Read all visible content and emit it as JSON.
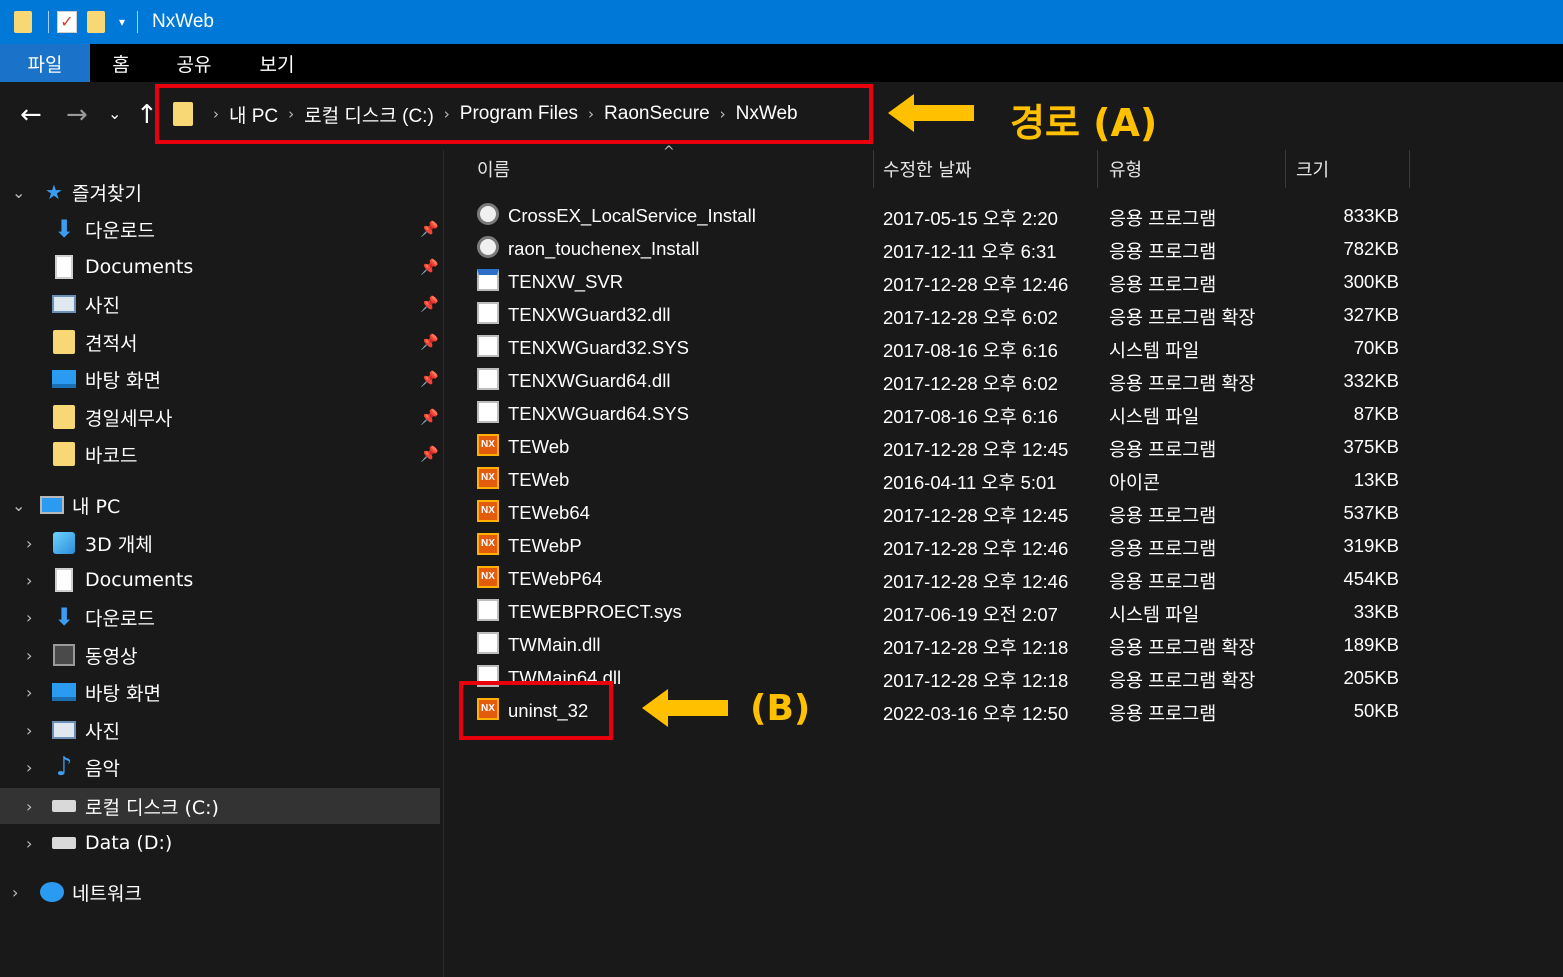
{
  "window": {
    "title": "NxWeb"
  },
  "ribbon": {
    "tabs": [
      "파일",
      "홈",
      "공유",
      "보기"
    ]
  },
  "address": {
    "crumbs": [
      "내 PC",
      "로컬 디스크 (C:)",
      "Program Files",
      "RaonSecure",
      "NxWeb"
    ]
  },
  "annotations": {
    "a": "경로 (A)",
    "b": "(B)",
    "color": "#ffc000",
    "box_color": "#e8000d"
  },
  "sidebar": {
    "quick_access": "즐겨찾기",
    "quick_items": [
      {
        "label": "다운로드",
        "icon": "download-arrow-icon"
      },
      {
        "label": "Documents",
        "icon": "documents-icon"
      },
      {
        "label": "사진",
        "icon": "pictures-icon"
      },
      {
        "label": "견적서",
        "icon": "folder-icon"
      },
      {
        "label": "바탕 화면",
        "icon": "desktop-icon"
      },
      {
        "label": "경일세무사",
        "icon": "folder-icon"
      },
      {
        "label": "바코드",
        "icon": "folder-icon"
      }
    ],
    "this_pc": "내 PC",
    "pc_items": [
      {
        "label": "3D 개체",
        "icon": "3d-objects-icon"
      },
      {
        "label": "Documents",
        "icon": "documents-icon"
      },
      {
        "label": "다운로드",
        "icon": "download-arrow-icon"
      },
      {
        "label": "동영상",
        "icon": "videos-icon"
      },
      {
        "label": "바탕 화면",
        "icon": "desktop-icon"
      },
      {
        "label": "사진",
        "icon": "pictures-icon"
      },
      {
        "label": "음악",
        "icon": "music-icon"
      },
      {
        "label": "로컬 디스크 (C:)",
        "icon": "local-disk-icon"
      },
      {
        "label": "Data (D:)",
        "icon": "drive-icon"
      }
    ],
    "network": "네트워크"
  },
  "columns": {
    "name": "이름",
    "date": "수정한 날짜",
    "type": "유형",
    "size": "크기"
  },
  "files": [
    {
      "name": "CrossEX_LocalService_Install",
      "date": "2017-05-15 오후 2:20",
      "type": "응용 프로그램",
      "size": "833KB",
      "icon": "installer-icon"
    },
    {
      "name": "raon_touchenex_Install",
      "date": "2017-12-11 오후 6:31",
      "type": "응용 프로그램",
      "size": "782KB",
      "icon": "installer-icon"
    },
    {
      "name": "TENXW_SVR",
      "date": "2017-12-28 오후 12:46",
      "type": "응용 프로그램",
      "size": "300KB",
      "icon": "window-app-icon"
    },
    {
      "name": "TENXWGuard32.dll",
      "date": "2017-12-28 오후 6:02",
      "type": "응용 프로그램 확장",
      "size": "327KB",
      "icon": "dll-file-icon"
    },
    {
      "name": "TENXWGuard32.SYS",
      "date": "2017-08-16 오후 6:16",
      "type": "시스템 파일",
      "size": "70KB",
      "icon": "system-file-icon"
    },
    {
      "name": "TENXWGuard64.dll",
      "date": "2017-12-28 오후 6:02",
      "type": "응용 프로그램 확장",
      "size": "332KB",
      "icon": "dll-file-icon"
    },
    {
      "name": "TENXWGuard64.SYS",
      "date": "2017-08-16 오후 6:16",
      "type": "시스템 파일",
      "size": "87KB",
      "icon": "system-file-icon"
    },
    {
      "name": "TEWeb",
      "date": "2017-12-28 오후 12:45",
      "type": "응용 프로그램",
      "size": "375KB",
      "icon": "nx-app-icon"
    },
    {
      "name": "TEWeb",
      "date": "2016-04-11 오후 5:01",
      "type": "아이콘",
      "size": "13KB",
      "icon": "nx-app-icon"
    },
    {
      "name": "TEWeb64",
      "date": "2017-12-28 오후 12:45",
      "type": "응용 프로그램",
      "size": "537KB",
      "icon": "nx-app-icon"
    },
    {
      "name": "TEWebP",
      "date": "2017-12-28 오후 12:46",
      "type": "응용 프로그램",
      "size": "319KB",
      "icon": "nx-app-icon"
    },
    {
      "name": "TEWebP64",
      "date": "2017-12-28 오후 12:46",
      "type": "응용 프로그램",
      "size": "454KB",
      "icon": "nx-app-icon"
    },
    {
      "name": "TEWEBPROECT.sys",
      "date": "2017-06-19 오전 2:07",
      "type": "시스템 파일",
      "size": "33KB",
      "icon": "system-file-icon"
    },
    {
      "name": "TWMain.dll",
      "date": "2017-12-28 오후 12:18",
      "type": "응용 프로그램 확장",
      "size": "189KB",
      "icon": "dll-file-icon"
    },
    {
      "name": "TWMain64.dll",
      "date": "2017-12-28 오후 12:18",
      "type": "응용 프로그램 확장",
      "size": "205KB",
      "icon": "dll-file-icon"
    },
    {
      "name": "uninst_32",
      "date": "2022-03-16 오후 12:50",
      "type": "응용 프로그램",
      "size": "50KB",
      "icon": "nx-app-icon"
    }
  ],
  "icon_glyphs": {
    "nx": "NX",
    "pin": "📌",
    "music": "♪",
    "quick_star": "★"
  }
}
